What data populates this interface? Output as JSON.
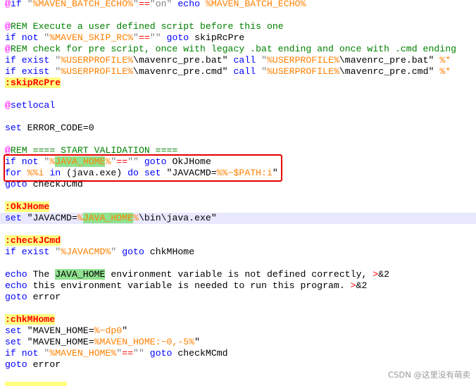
{
  "editor": {
    "lines": [
      [
        {
          "t": "@",
          "c": "at"
        },
        {
          "t": "if ",
          "c": "cmd"
        },
        {
          "t": "\"",
          "c": "str"
        },
        {
          "t": "%MAVEN_BATCH_ECHO%",
          "c": "var"
        },
        {
          "t": "\"",
          "c": "str"
        },
        {
          "t": "==",
          "c": "op"
        },
        {
          "t": "\"on\"",
          "c": "str"
        },
        {
          "t": " echo ",
          "c": "cmd"
        },
        {
          "t": "%MAVEN_BATCH_ECHO%",
          "c": "var"
        }
      ],
      [],
      [
        {
          "t": "@",
          "c": "at"
        },
        {
          "t": "REM Execute a user defined script before this one",
          "c": "rem"
        }
      ],
      [
        {
          "t": "if not ",
          "c": "cmd"
        },
        {
          "t": "\"",
          "c": "str"
        },
        {
          "t": "%MAVEN_SKIP_RC%",
          "c": "var"
        },
        {
          "t": "\"",
          "c": "str"
        },
        {
          "t": "==",
          "c": "op"
        },
        {
          "t": "\"\"",
          "c": "str"
        },
        {
          "t": " goto ",
          "c": "cmd"
        },
        {
          "t": "skipRcPre",
          "c": "txt"
        }
      ],
      [
        {
          "t": "@",
          "c": "at"
        },
        {
          "t": "REM check for pre script, once with legacy .bat ending and once with .cmd ending",
          "c": "rem"
        }
      ],
      [
        {
          "t": "if exist ",
          "c": "cmd"
        },
        {
          "t": "\"",
          "c": "str"
        },
        {
          "t": "%USERPROFILE%",
          "c": "var"
        },
        {
          "t": "\\mavenrc_pre.bat\"",
          "c": "txt"
        },
        {
          "t": " call ",
          "c": "cmd"
        },
        {
          "t": "\"",
          "c": "str"
        },
        {
          "t": "%USERPROFILE%",
          "c": "var"
        },
        {
          "t": "\\mavenrc_pre.bat\"",
          "c": "txt"
        },
        {
          "t": " %*",
          "c": "var"
        }
      ],
      [
        {
          "t": "if exist ",
          "c": "cmd"
        },
        {
          "t": "\"",
          "c": "str"
        },
        {
          "t": "%USERPROFILE%",
          "c": "var"
        },
        {
          "t": "\\mavenrc_pre.cmd\"",
          "c": "txt"
        },
        {
          "t": " call ",
          "c": "cmd"
        },
        {
          "t": "\"",
          "c": "str"
        },
        {
          "t": "%USERPROFILE%",
          "c": "var"
        },
        {
          "t": "\\mavenrc_pre.cmd\"",
          "c": "txt"
        },
        {
          "t": " %*",
          "c": "var"
        }
      ],
      [
        {
          "t": ":skipRcPre",
          "c": "lbl"
        }
      ],
      [],
      [
        {
          "t": "@",
          "c": "at"
        },
        {
          "t": "setlocal",
          "c": "cmd"
        }
      ],
      [],
      [
        {
          "t": "set ",
          "c": "cmd"
        },
        {
          "t": "ERROR_CODE=0",
          "c": "txt"
        }
      ],
      [],
      [
        {
          "t": "@",
          "c": "at"
        },
        {
          "t": "REM ==== START VALIDATION ====",
          "c": "rem"
        }
      ],
      [
        {
          "t": "if not ",
          "c": "cmd"
        },
        {
          "t": "\"",
          "c": "str"
        },
        {
          "t": "%",
          "c": "var"
        },
        {
          "t": "JAVA_HOME",
          "c": "var",
          "h": true
        },
        {
          "t": "%",
          "c": "var"
        },
        {
          "t": "\"",
          "c": "str"
        },
        {
          "t": "==",
          "c": "op"
        },
        {
          "t": "\"\"",
          "c": "str"
        },
        {
          "t": " goto ",
          "c": "cmd"
        },
        {
          "t": "OkJHome",
          "c": "txt"
        }
      ],
      [
        {
          "t": "for ",
          "c": "cmd"
        },
        {
          "t": "%%i",
          "c": "var"
        },
        {
          "t": " in ",
          "c": "cmd"
        },
        {
          "t": "(java.exe)",
          "c": "txt"
        },
        {
          "t": " do set ",
          "c": "cmd"
        },
        {
          "t": "\"JAVACMD=",
          "c": "txt"
        },
        {
          "t": "%%~$PATH:i",
          "c": "var"
        },
        {
          "t": "\"",
          "c": "txt"
        }
      ],
      [
        {
          "t": "goto ",
          "c": "cmd"
        },
        {
          "t": "checkJCmd",
          "c": "txt"
        }
      ],
      [],
      [
        {
          "t": ":OkJHome",
          "c": "lbl"
        }
      ],
      [
        {
          "t": "set ",
          "c": "cmd"
        },
        {
          "t": "\"JAVACMD=",
          "c": "txt"
        },
        {
          "t": "%",
          "c": "var"
        },
        {
          "t": "JAVA_HOME",
          "c": "var",
          "h": true
        },
        {
          "t": "%",
          "c": "var"
        },
        {
          "t": "\\bin\\java.exe\"",
          "c": "txt"
        }
      ],
      [],
      [
        {
          "t": ":checkJCmd",
          "c": "lbl"
        }
      ],
      [
        {
          "t": "if exist ",
          "c": "cmd"
        },
        {
          "t": "\"",
          "c": "str"
        },
        {
          "t": "%JAVACMD%",
          "c": "var"
        },
        {
          "t": "\"",
          "c": "str"
        },
        {
          "t": " goto ",
          "c": "cmd"
        },
        {
          "t": "chkMHome",
          "c": "txt"
        }
      ],
      [],
      [
        {
          "t": "echo ",
          "c": "cmd"
        },
        {
          "t": "The ",
          "c": "txt"
        },
        {
          "t": "JAVA_HOME",
          "c": "txt",
          "h": true
        },
        {
          "t": " environment variable is not defined correctly, ",
          "c": "txt"
        },
        {
          "t": ">",
          "c": "redir"
        },
        {
          "t": "&2",
          "c": "txt"
        }
      ],
      [
        {
          "t": "echo ",
          "c": "cmd"
        },
        {
          "t": "this environment variable is needed to run this program. ",
          "c": "txt"
        },
        {
          "t": ">",
          "c": "redir"
        },
        {
          "t": "&2",
          "c": "txt"
        }
      ],
      [
        {
          "t": "goto ",
          "c": "cmd"
        },
        {
          "t": "error",
          "c": "txt"
        }
      ],
      [],
      [
        {
          "t": ":chkMHome",
          "c": "lbl"
        }
      ],
      [
        {
          "t": "set ",
          "c": "cmd"
        },
        {
          "t": "\"MAVEN_HOME=",
          "c": "txt"
        },
        {
          "t": "%~dp0",
          "c": "var"
        },
        {
          "t": "\"",
          "c": "txt"
        }
      ],
      [
        {
          "t": "set ",
          "c": "cmd"
        },
        {
          "t": "\"MAVEN_HOME=",
          "c": "txt"
        },
        {
          "t": "%MAVEN_HOME:~0,-5%",
          "c": "var"
        },
        {
          "t": "\"",
          "c": "txt"
        }
      ],
      [
        {
          "t": "if not ",
          "c": "cmd"
        },
        {
          "t": "\"",
          "c": "str"
        },
        {
          "t": "%MAVEN_HOME%",
          "c": "var"
        },
        {
          "t": "\"",
          "c": "str"
        },
        {
          "t": "==",
          "c": "op"
        },
        {
          "t": "\"\"",
          "c": "str"
        },
        {
          "t": " goto ",
          "c": "cmd"
        },
        {
          "t": "checkMCmd",
          "c": "txt"
        }
      ],
      [
        {
          "t": "goto ",
          "c": "cmd"
        },
        {
          "t": "error",
          "c": "txt"
        }
      ]
    ],
    "current_line": 19
  },
  "watermark": "CSDN @这里没有萌卖"
}
